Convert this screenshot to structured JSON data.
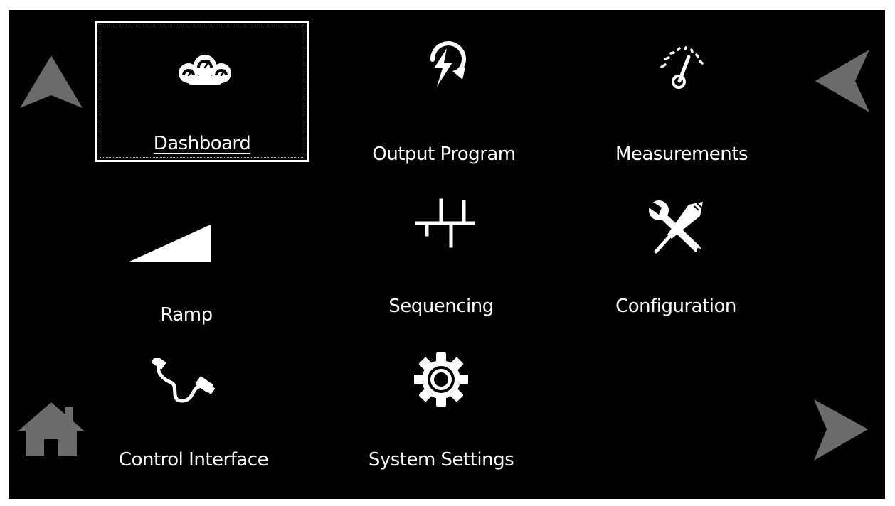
{
  "theme": {
    "background": "#000000",
    "foreground": "#ffffff",
    "nav_arrow_color": "#6b6b6b"
  },
  "navigation": {
    "up_icon": "triangle-up-icon",
    "back_icon": "triangle-left-icon",
    "home_icon": "home-icon",
    "forward_icon": "triangle-right-icon"
  },
  "menu": {
    "selected": "Dashboard",
    "items": [
      {
        "label": "Dashboard",
        "icon": "dashboard-gauges-icon"
      },
      {
        "label": "Output Program",
        "icon": "power-cycle-bolt-icon"
      },
      {
        "label": "Measurements",
        "icon": "meter-gauge-icon"
      },
      {
        "label": "Ramp",
        "icon": "ramp-wedge-icon"
      },
      {
        "label": "Sequencing",
        "icon": "sequence-pulses-icon"
      },
      {
        "label": "Configuration",
        "icon": "wrench-screwdriver-icon"
      },
      {
        "label": "Control Interface",
        "icon": "usb-cable-icon"
      },
      {
        "label": "System Settings",
        "icon": "gear-icon"
      }
    ]
  }
}
